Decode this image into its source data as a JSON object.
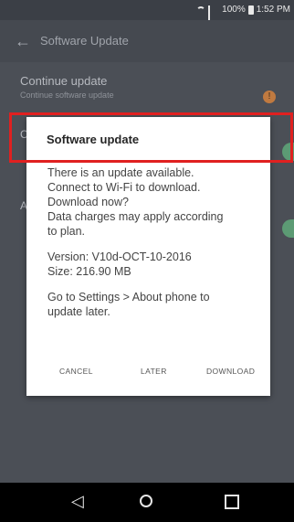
{
  "status_bar": {
    "battery_percent": "100%",
    "time": "1:52 PM"
  },
  "app_bar": {
    "title": "Software Update"
  },
  "list": {
    "row1_title": "Continue update",
    "row1_subtitle": "Continue software update",
    "row1_badge": "!",
    "row2_prefix": "C",
    "row3_prefix": "A"
  },
  "dialog": {
    "title": "Software update",
    "message_lines": [
      "There is an update available.",
      "Connect to Wi-Fi to download.",
      "Download now?",
      "Data charges may apply according",
      "to plan."
    ],
    "version": "Version: V10d-OCT-10-2016",
    "size": "Size: 216.90 MB",
    "hint_lines": [
      "Go to Settings > About phone to",
      "update later."
    ],
    "buttons": {
      "cancel": "CANCEL",
      "later": "LATER",
      "download": "DOWNLOAD"
    }
  },
  "highlight_color": "#e02020",
  "icons": [
    "wifi-icon",
    "signal-icon",
    "battery-icon",
    "back-arrow-icon",
    "nav-back-icon",
    "nav-home-icon",
    "nav-recent-icon"
  ]
}
